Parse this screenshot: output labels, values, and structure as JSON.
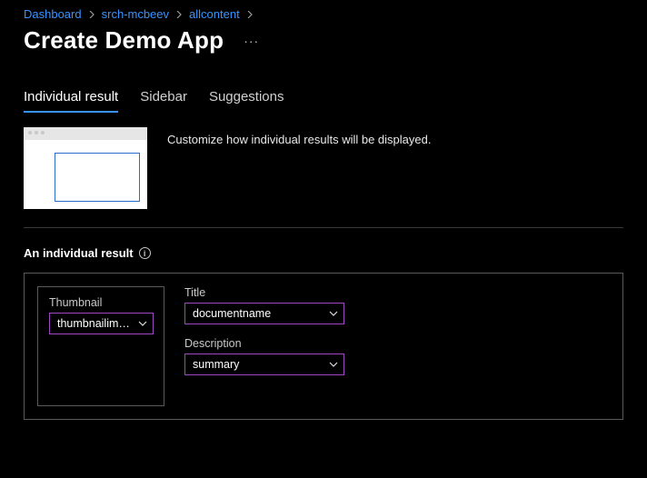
{
  "breadcrumb": {
    "items": [
      {
        "label": "Dashboard"
      },
      {
        "label": "srch-mcbeev"
      },
      {
        "label": "allcontent"
      }
    ]
  },
  "page": {
    "title": "Create Demo App",
    "more_label": "···"
  },
  "tabs": {
    "items": [
      {
        "label": "Individual result",
        "active": true
      },
      {
        "label": "Sidebar",
        "active": false
      },
      {
        "label": "Suggestions",
        "active": false
      }
    ],
    "description": "Customize how individual results will be displayed."
  },
  "section": {
    "heading": "An individual result"
  },
  "form": {
    "thumbnail": {
      "label": "Thumbnail",
      "value": "thumbnailimageurl"
    },
    "title": {
      "label": "Title",
      "value": "documentname"
    },
    "description": {
      "label": "Description",
      "value": "summary"
    }
  },
  "colors": {
    "link": "#3794ff",
    "accent": "#a146c2"
  }
}
